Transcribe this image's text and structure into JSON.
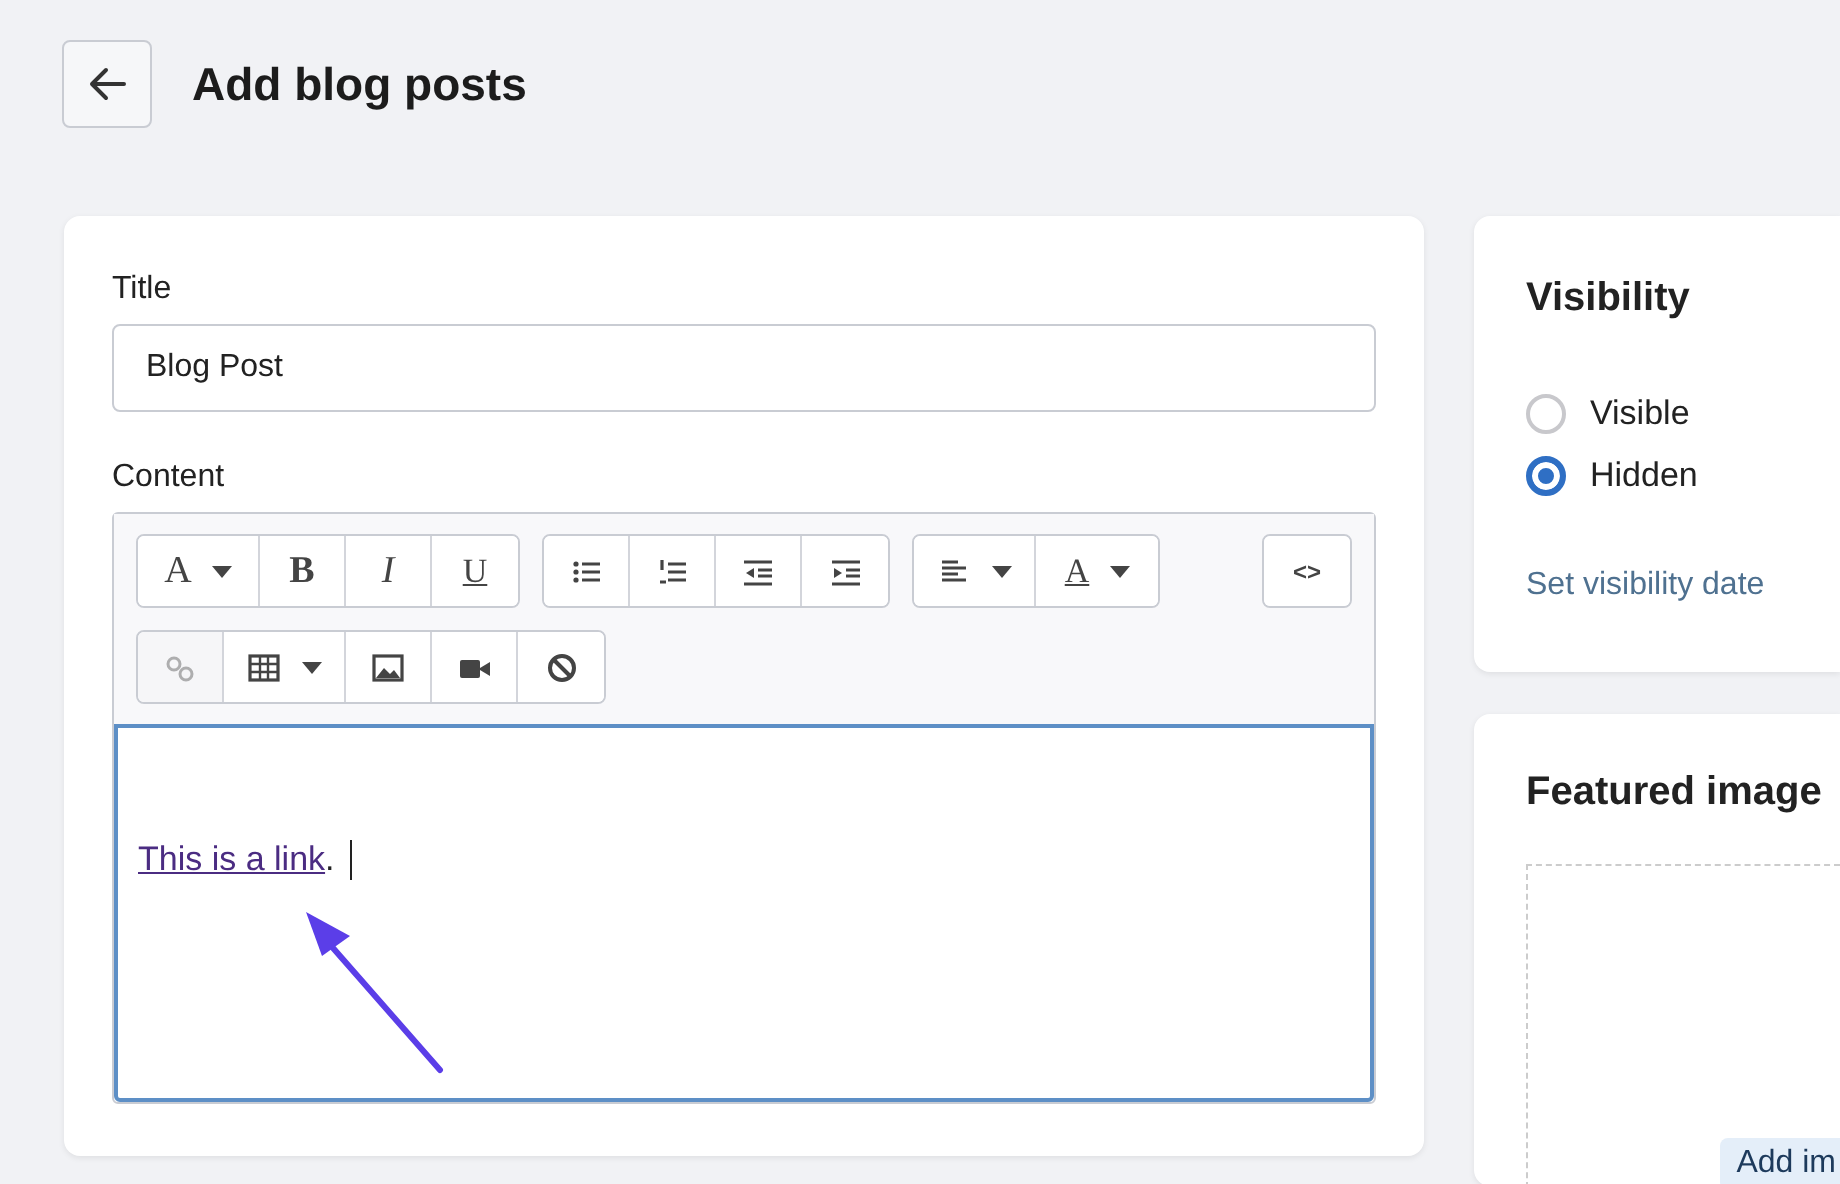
{
  "header": {
    "title": "Add blog posts"
  },
  "post_form": {
    "title_label": "Title",
    "title_value": "Blog Post",
    "content_label": "Content",
    "toolbar_rows": [
      [
        [
          {
            "kind": "font",
            "label": "A",
            "disabled": false
          },
          {
            "kind": "bold",
            "label": "B",
            "disabled": false
          },
          {
            "kind": "italic",
            "label": "I",
            "disabled": false
          },
          {
            "kind": "underline",
            "label": "U",
            "disabled": false
          }
        ],
        [
          {
            "kind": "bullets",
            "disabled": false
          },
          {
            "kind": "numbers",
            "disabled": false
          },
          {
            "kind": "outdent",
            "disabled": false
          },
          {
            "kind": "indent",
            "disabled": false
          }
        ],
        [
          {
            "kind": "align",
            "disabled": false
          },
          {
            "kind": "color",
            "label": "A",
            "disabled": false
          }
        ],
        [
          {
            "kind": "code",
            "label": "<>",
            "disabled": false
          }
        ]
      ],
      [
        [
          {
            "kind": "link",
            "disabled": true
          },
          {
            "kind": "table",
            "disabled": false
          },
          {
            "kind": "image",
            "disabled": false
          },
          {
            "kind": "video",
            "disabled": false
          },
          {
            "kind": "clear",
            "disabled": false
          }
        ]
      ]
    ],
    "content": {
      "link_text": "This is a link",
      "after": "."
    }
  },
  "visibility": {
    "heading": "Visibility",
    "options": [
      {
        "label": "Visible",
        "selected": false
      },
      {
        "label": "Hidden",
        "selected": true
      }
    ],
    "date_link": "Set visibility date"
  },
  "featured_image": {
    "heading": "Featured image",
    "button": "Add im"
  }
}
